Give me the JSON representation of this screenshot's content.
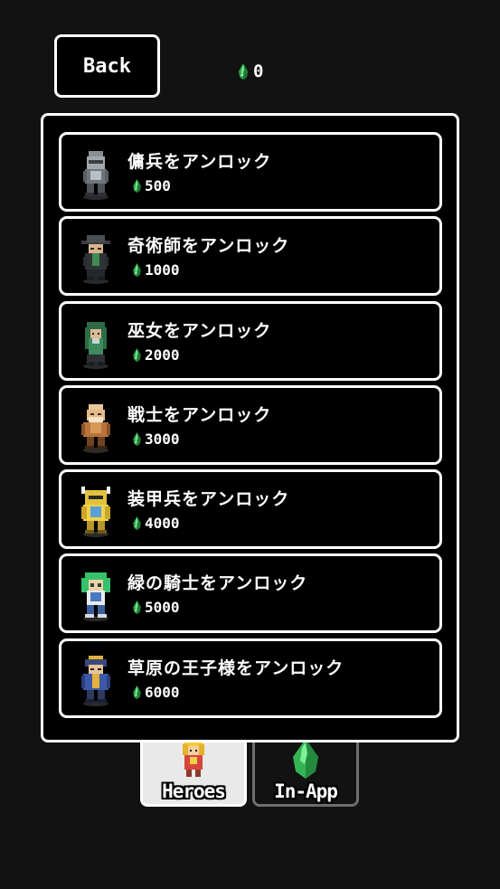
{
  "header": {
    "back_label": "Back",
    "currency_amount": "0",
    "currency_icon": "green-gem-icon"
  },
  "unlock_list": [
    {
      "label": "傭兵をアンロック",
      "price": "500",
      "sprite": "mercenary-sprite"
    },
    {
      "label": "奇術師をアンロック",
      "price": "1000",
      "sprite": "magician-sprite"
    },
    {
      "label": "巫女をアンロック",
      "price": "2000",
      "sprite": "shrine-maiden-sprite"
    },
    {
      "label": "戦士をアンロック",
      "price": "3000",
      "sprite": "warrior-sprite"
    },
    {
      "label": "装甲兵をアンロック",
      "price": "4000",
      "sprite": "armored-soldier-sprite"
    },
    {
      "label": "緑の騎士をアンロック",
      "price": "5000",
      "sprite": "green-knight-sprite"
    },
    {
      "label": "草原の王子様をアンロック",
      "price": "6000",
      "sprite": "meadow-prince-sprite"
    }
  ],
  "tabs": [
    {
      "label": "Heroes",
      "icon": "hero-sprite-icon",
      "active": true
    },
    {
      "label": "In-App",
      "icon": "green-gem-icon",
      "active": false
    }
  ],
  "colors": {
    "background": "#121212",
    "panel": "#000000",
    "border": "#ffffff",
    "gem": "#3cc25a",
    "active_tab": "#e9e9e9",
    "inactive_tab_border": "#6e6e6e"
  }
}
